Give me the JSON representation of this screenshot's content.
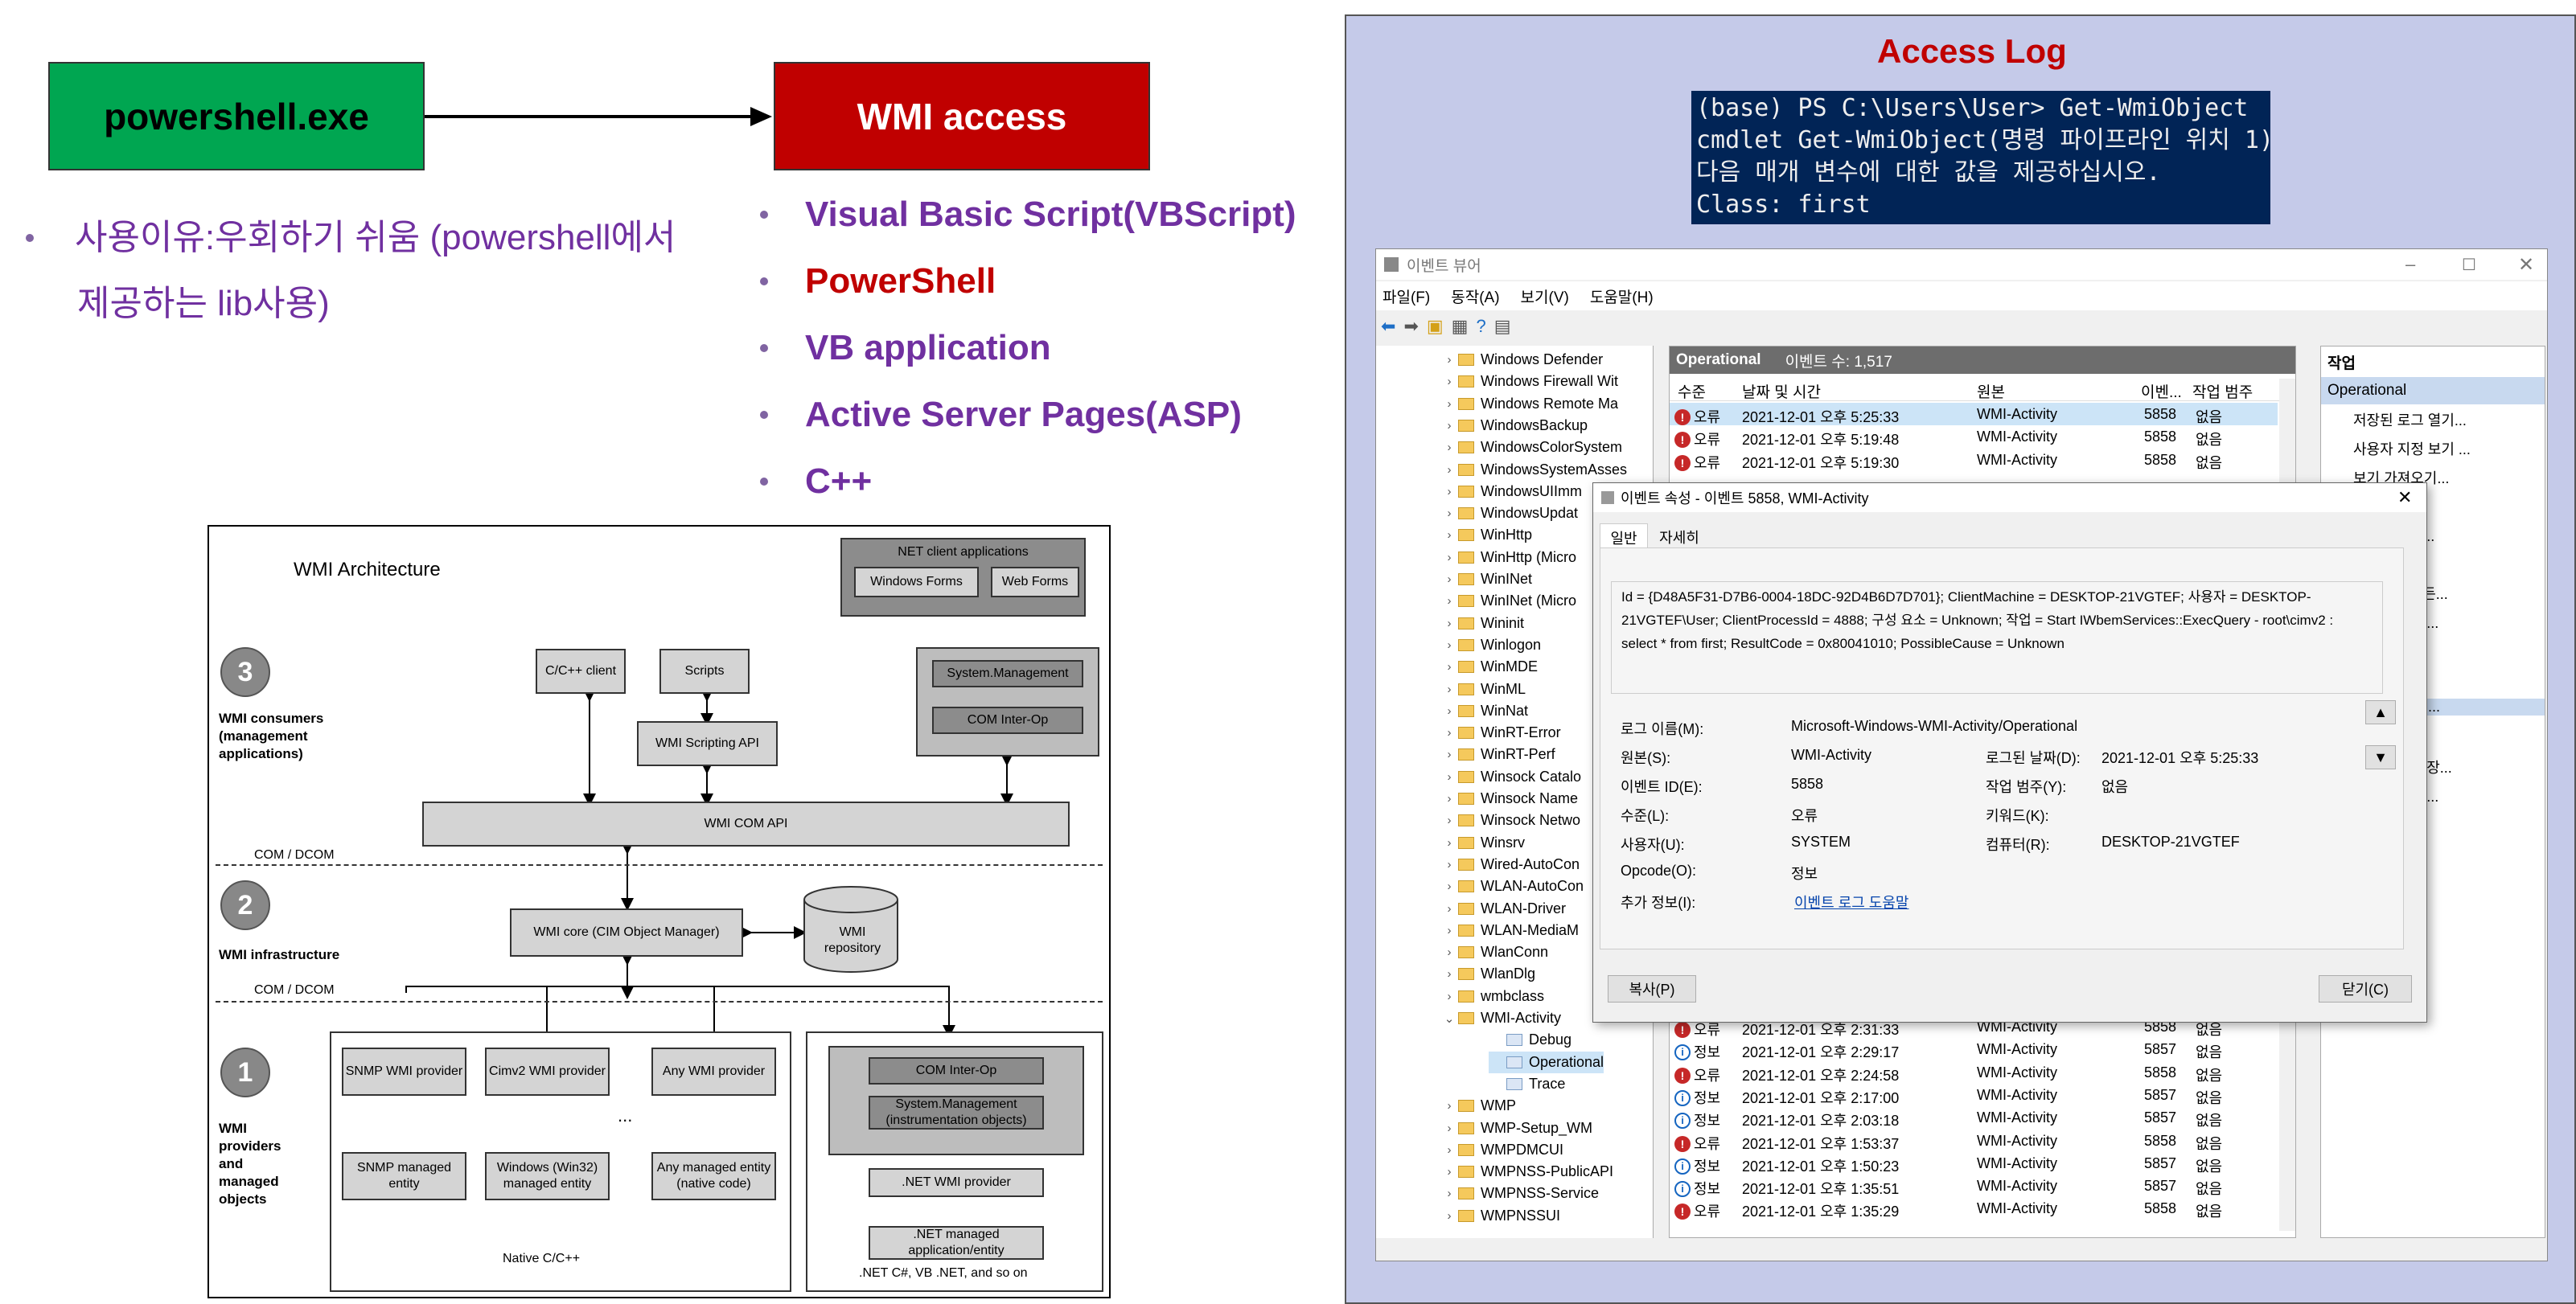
{
  "flow": {
    "left_box": "powershell.exe",
    "right_box": "WMI access"
  },
  "left_bullet": {
    "line1": "사용이유:우회하기 쉬움 (powershell에서",
    "line2": "제공하는 lib사용)"
  },
  "wmi_list": [
    "Visual Basic Script(VBScript)",
    "PowerShell",
    "VB application",
    "Active Server Pages(ASP)",
    "C++"
  ],
  "arch": {
    "title": "WMI Architecture",
    "net_clients": "NET client applications",
    "win_forms": "Windows Forms",
    "web_forms": "Web Forms",
    "cpp_client": "C/C++ client",
    "scripts": "Scripts",
    "sys_mgmt": "System.Management",
    "com_interop": "COM Inter-Op",
    "scripting_api": "WMI Scripting API",
    "com_api": "WMI COM API",
    "com_dcom_1": "COM / DCOM",
    "com_dcom_2": "COM / DCOM",
    "core": "WMI core (CIM Object Manager)",
    "repository": "WMI repository",
    "n3": "3",
    "n2": "2",
    "n1": "1",
    "consumers": "WMI consumers (management applications)",
    "infrastructure": "WMI infrastructure",
    "providers": "WMI providers and managed objects",
    "snmp_provider": "SNMP WMI provider",
    "cimv2_provider": "Cimv2 WMI provider",
    "any_provider": "Any WMI provider",
    "dots": "...",
    "snmp_entity": "SNMP managed entity",
    "windows_entity": "Windows (Win32) managed entity",
    "any_entity": "Any managed entity (native code)",
    "native": "Native C/C++",
    "com_interop_2": "COM Inter-Op",
    "sys_mgmt_2": "System.Management (instrumentation objects)",
    "net_provider": ".NET WMI provider",
    "net_managed": ".NET managed application/entity",
    "net_langs": ".NET C#, VB .NET, and so on"
  },
  "access_log": {
    "title": "Access Log",
    "terminal": [
      "(base) PS C:\\Users\\User> Get-WmiObject",
      "cmdlet Get-WmiObject(명령 파이프라인 위치 1)",
      "다음 매개 변수에 대한 값을 제공하십시오.",
      "Class: first"
    ]
  },
  "viewer": {
    "title": "이벤트 뷰어",
    "menu": [
      "파일(F)",
      "동작(A)",
      "보기(V)",
      "도움말(H)"
    ],
    "tree": [
      "Windows Defender",
      "Windows Firewall Wit",
      "Windows Remote Ma",
      "WindowsBackup",
      "WindowsColorSystem",
      "WindowsSystemAsses",
      "WindowsUIImm",
      "WindowsUpdat",
      "WinHttp",
      "WinHttp (Micro",
      "WinINet",
      "WinINet (Micro",
      "Wininit",
      "Winlogon",
      "WinMDE",
      "WinML",
      "WinNat",
      "WinRT-Error",
      "WinRT-Perf",
      "Winsock Catalo",
      "Winsock Name",
      "Winsock Netwo",
      "Winsrv",
      "Wired-AutoCon",
      "WLAN-AutoCon",
      "WLAN-Driver",
      "WLAN-MediaM",
      "WlanConn",
      "WlanDlg",
      "wmbclass",
      "WMI-Activity",
      "Debug",
      "Operational",
      "Trace",
      "WMP",
      "WMP-Setup_WM",
      "WMPDMCUI",
      "WMPNSS-PublicAPI",
      "WMPNSS-Service",
      "WMPNSSUI"
    ],
    "log_header": "Operational",
    "event_count": "이벤트 수: 1,517",
    "columns": [
      "수준",
      "날짜 및 시간",
      "원본",
      "이벤...",
      "작업 범주"
    ],
    "top_rows": [
      {
        "level": "오류",
        "date": "2021-12-01 오후 5:25:33",
        "source": "WMI-Activity",
        "id": "5858",
        "cat": "없음"
      },
      {
        "level": "오류",
        "date": "2021-12-01 오후 5:19:48",
        "source": "WMI-Activity",
        "id": "5858",
        "cat": "없음"
      },
      {
        "level": "오류",
        "date": "2021-12-01 오후 5:19:30",
        "source": "WMI-Activity",
        "id": "5858",
        "cat": "없음"
      }
    ],
    "bottom_rows": [
      {
        "level": "오류",
        "date": "2021-12-01 오후 2:31:33",
        "source": "WMI-Activity",
        "id": "5858",
        "cat": "없음"
      },
      {
        "level": "정보",
        "date": "2021-12-01 오후 2:29:17",
        "source": "WMI-Activity",
        "id": "5857",
        "cat": "없음"
      },
      {
        "level": "오류",
        "date": "2021-12-01 오후 2:24:58",
        "source": "WMI-Activity",
        "id": "5858",
        "cat": "없음"
      },
      {
        "level": "정보",
        "date": "2021-12-01 오후 2:17:00",
        "source": "WMI-Activity",
        "id": "5857",
        "cat": "없음"
      },
      {
        "level": "정보",
        "date": "2021-12-01 오후 2:03:18",
        "source": "WMI-Activity",
        "id": "5857",
        "cat": "없음"
      },
      {
        "level": "오류",
        "date": "2021-12-01 오후 1:53:37",
        "source": "WMI-Activity",
        "id": "5858",
        "cat": "없음"
      },
      {
        "level": "정보",
        "date": "2021-12-01 오후 1:50:23",
        "source": "WMI-Activity",
        "id": "5857",
        "cat": "없음"
      },
      {
        "level": "정보",
        "date": "2021-12-01 오후 1:35:51",
        "source": "WMI-Activity",
        "id": "5857",
        "cat": "없음"
      },
      {
        "level": "오류",
        "date": "2021-12-01 오후 1:35:29",
        "source": "WMI-Activity",
        "id": "5858",
        "cat": "없음"
      }
    ],
    "actions_header": "작업",
    "actions_section": "Operational",
    "actions": [
      "저장된 로그 열기...",
      "사용자 지정 보기 ...",
      "보기 가져오기...",
      "...우기...",
      "...그 필터링...",
      "...사용 안 함",
      "...름으로 모든...",
      "...에 작업 연...",
      "",
      "...침",
      "8, WMI-Acti...",
      "...속성",
      "... 이벤트 저장...",
      "...트에 작업 ...",
      "",
      "...침"
    ]
  },
  "dialog": {
    "title": "이벤트 속성 - 이벤트 5858, WMI-Activity",
    "tab_general": "일반",
    "tab_details": "자세히",
    "message": "Id = {D48A5F31-D7B6-0004-18DC-92D4B6D7D701}; ClientMachine = DESKTOP-21VGTEF; 사용자 = DESKTOP-21VGTEF\\User; ClientProcessId = 4888; 구성 요소 = Unknown; 작업 = Start IWbemServices::ExecQuery - root\\cimv2 : select * from first; ResultCode = 0x80041010; PossibleCause = Unknown",
    "log_name_label": "로그 이름(M):",
    "log_name": "Microsoft-Windows-WMI-Activity/Operational",
    "source_label": "원본(S):",
    "source": "WMI-Activity",
    "logged_label": "로그된 날짜(D):",
    "logged": "2021-12-01 오후 5:25:33",
    "event_id_label": "이벤트 ID(E):",
    "event_id": "5858",
    "task_label": "작업 범주(Y):",
    "task": "없음",
    "level_label": "수준(L):",
    "level": "오류",
    "keywords_label": "키워드(K):",
    "user_label": "사용자(U):",
    "user": "SYSTEM",
    "computer_label": "컴퓨터(R):",
    "computer": "DESKTOP-21VGTEF",
    "opcode_label": "Opcode(O):",
    "opcode": "정보",
    "more_label": "추가 정보(I):",
    "more_link": "이벤트 로그 도움말",
    "copy": "복사(P)",
    "close": "닫기(C)"
  }
}
